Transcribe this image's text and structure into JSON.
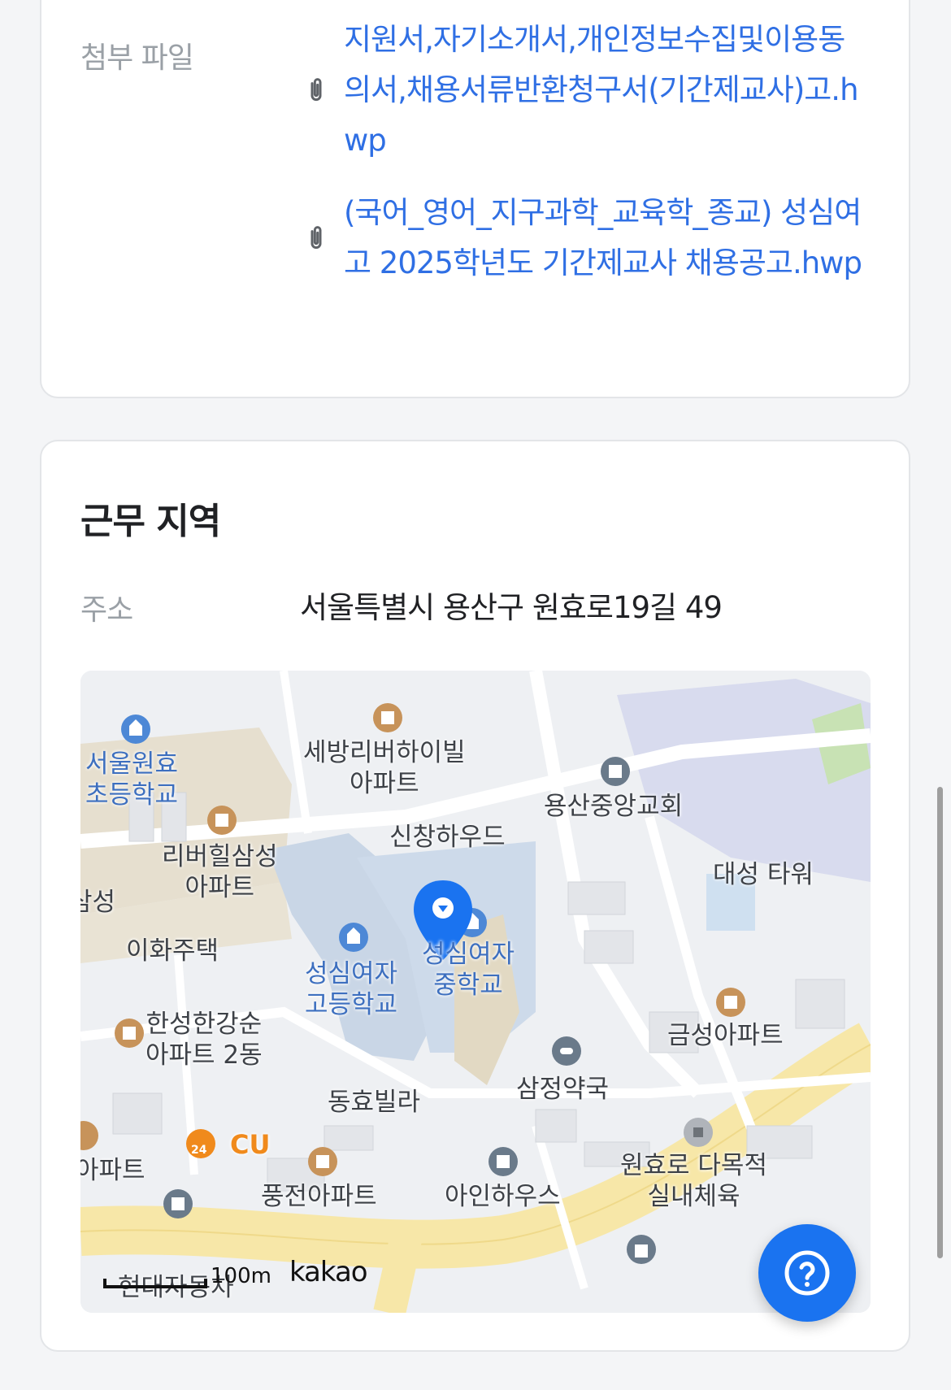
{
  "attachments": {
    "label": "첨부 파일",
    "files": [
      "지원서,자기소개서,개인정보수집및이용동의서,채용서류반환청구서(기간제교사)고.hwp",
      "(국어_영어_지구과학_교육학_종교) 성심여고 2025학년도 기간제교사 채용공고.hwp"
    ]
  },
  "location": {
    "title": "근무 지역",
    "address_label": "주소",
    "address": "서울특별시 용산구 원효로19길 49"
  },
  "map": {
    "places": {
      "wonhyo_elem": "서울원효\n초등학교",
      "sebang": "세방리버하이빌\n아파트",
      "yongsan_church": "용산중앙교회",
      "sinchang": "신창하우드",
      "riverhill": "리버힐삼성\n아파트",
      "daesung": "대성 타워",
      "seong_left": "삼성",
      "ihwa": "이화주택",
      "seongsim_high": "성심여자\n고등학교",
      "seongsim_mid": "성심여자\n중학교",
      "hansung": "한성한강순\n아파트 2동",
      "geumseong": "금성아파트",
      "samjeong": "삼정약국",
      "donghyo": "동효빌라",
      "cu": "CU",
      "cu_badge": "24",
      "apt_left": "아파트",
      "pungjeon": "풍전아파트",
      "ain": "아인하우스",
      "wonhyoro": "원효로 다목적\n실내체육",
      "hyundai": "현대자동차"
    },
    "scale": "100m",
    "attribution": "kakao"
  },
  "colors": {
    "link": "#2f6fe4",
    "accent": "#1a73f0",
    "marker": "#1a73f0"
  },
  "icons": {
    "attachment": "paperclip-icon",
    "help": "question-icon",
    "marker": "map-pin-icon"
  }
}
